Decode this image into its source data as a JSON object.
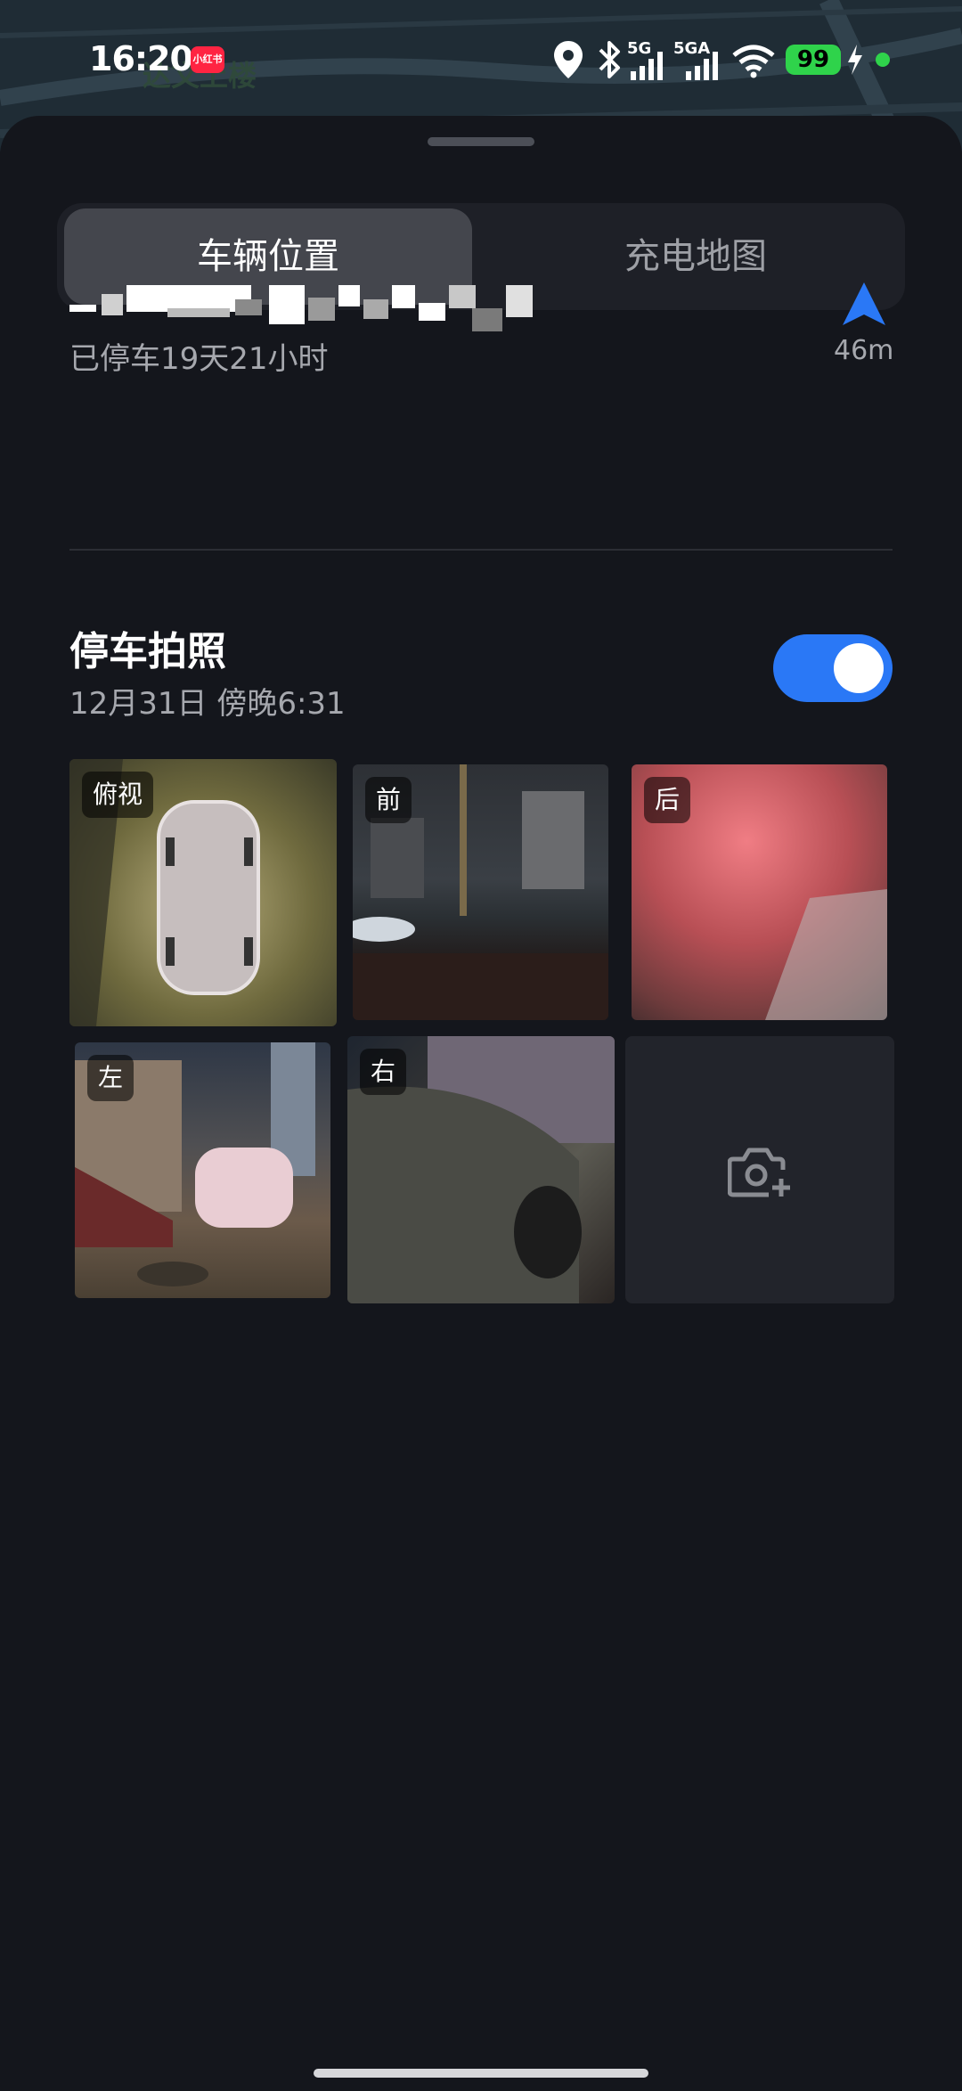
{
  "status_bar": {
    "time": "16:20",
    "app_badge": "小红书",
    "map_text": "达文上楼",
    "network_1": "5G",
    "network_2": "5GA",
    "battery": "99"
  },
  "tabs": [
    {
      "label": "车辆位置",
      "active": true
    },
    {
      "label": "充电地图",
      "active": false
    }
  ],
  "location": {
    "parked_duration": "已停车19天21小时",
    "distance": "46m"
  },
  "parking_photos": {
    "title": "停车拍照",
    "timestamp": "12月31日 傍晚6:31",
    "toggle_on": true,
    "photos": [
      {
        "label": "俯视",
        "icon": "overhead-view"
      },
      {
        "label": "前",
        "icon": "front-camera"
      },
      {
        "label": "后",
        "icon": "rear-camera"
      },
      {
        "label": "左",
        "icon": "left-camera"
      },
      {
        "label": "右",
        "icon": "right-camera"
      }
    ],
    "add_photo_icon": "camera-add-icon"
  },
  "colors": {
    "background": "#14161c",
    "accent": "#2a78f6",
    "battery": "#2fd34b"
  }
}
